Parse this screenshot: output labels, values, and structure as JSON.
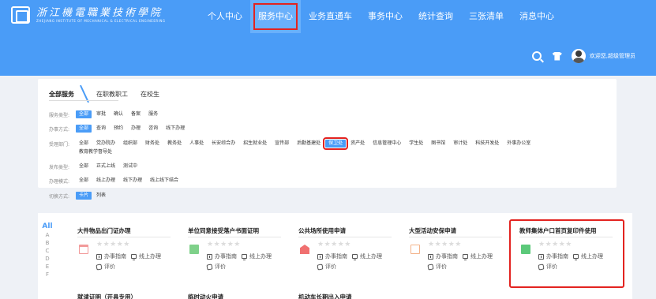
{
  "header": {
    "logo_cn": "浙江機電職業技術學院",
    "logo_en": "ZHEJIANG INSTITUTE OF MECHANICAL & ELECTRICAL ENGINEERING",
    "nav": [
      "个人中心",
      "服务中心",
      "业务直通车",
      "事务中心",
      "统计查询",
      "三张清单",
      "消息中心"
    ],
    "active_nav": "服务中心",
    "welcome": "欢迎您,超级管理员",
    "bg_color": "#4a9cf7"
  },
  "tabs": [
    "全部服务",
    "在职教职工",
    "在校生"
  ],
  "filters": [
    {
      "label": "服务类型:",
      "options": [
        "全部",
        "审批",
        "确认",
        "备案",
        "服务"
      ]
    },
    {
      "label": "办事方式:",
      "options": [
        "全部",
        "查询",
        "预约",
        "办理",
        "咨询",
        "线下办理"
      ]
    },
    {
      "label": "受理部门:",
      "options": [
        "全部",
        "党办院办",
        "组织部",
        "财务处",
        "教务处",
        "人事处",
        "长安综合办",
        "招生就业处",
        "宣传部",
        "后勤基建处",
        "保卫处",
        "资产处",
        "信息管理中心",
        "学生处",
        "图书馆",
        "审计处",
        "科技开发处",
        "外事办公室"
      ],
      "options2": [
        "教育教学督导处"
      ]
    },
    {
      "label": "发布类型:",
      "options": [
        "全部",
        "正式上线",
        "测试中"
      ]
    },
    {
      "label": "办理模式:",
      "options": [
        "全部",
        "线上办理",
        "线下办理",
        "线上线下结合"
      ]
    },
    {
      "label": "切换方式:",
      "options": [
        "卡片",
        "列表"
      ]
    }
  ],
  "alpha": {
    "all": "All",
    "letters": [
      "A",
      "B",
      "C",
      "D",
      "E",
      "F"
    ]
  },
  "cards": [
    {
      "title": "大件物品出门证办理",
      "guide": "办事指南",
      "mode": "线上办理",
      "rate": "评价",
      "icon_color": "#f29a9a"
    },
    {
      "title": "单位同意接受落户书面证明",
      "guide": "办事指南",
      "mode": "线上办理",
      "rate": "评价",
      "icon_color": "#7fd18a"
    },
    {
      "title": "公共场所使用申请",
      "guide": "办事指南",
      "mode": "线上办理",
      "rate": "评价",
      "icon_color": "#f07070"
    },
    {
      "title": "大型活动安保申请",
      "guide": "办事指南",
      "mode": "线上办理",
      "rate": "评价",
      "icon_color": "#f3b38a"
    },
    {
      "title": "教师集体户口首页复印件使用",
      "guide": "办事指南",
      "mode": "线上办理",
      "rate": "评价",
      "icon_color": "#5cc97a"
    }
  ],
  "bottom_titles": [
    "就读证明（开具专用）",
    "临时动火申请",
    "机动车长期出入申请"
  ],
  "highlight_color": "#e32320"
}
